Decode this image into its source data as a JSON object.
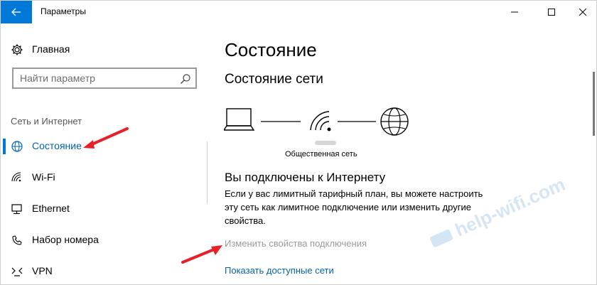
{
  "window": {
    "title": "Параметры"
  },
  "sidebar": {
    "home_label": "Главная",
    "search": {
      "placeholder": "Найти параметр"
    },
    "section_label": "Сеть и Интернет",
    "items": [
      {
        "label": "Состояние",
        "icon": "globe-status-icon",
        "active": true
      },
      {
        "label": "Wi-Fi",
        "icon": "wifi-icon",
        "active": false
      },
      {
        "label": "Ethernet",
        "icon": "ethernet-icon",
        "active": false
      },
      {
        "label": "Набор номера",
        "icon": "dialup-icon",
        "active": false
      },
      {
        "label": "VPN",
        "icon": "vpn-icon",
        "active": false
      }
    ]
  },
  "main": {
    "page_title": "Состояние",
    "network_status_title": "Состояние сети",
    "network_type": "Общественная сеть",
    "connected_title": "Вы подключены к Интернету",
    "connected_desc": "Если у вас лимитный тарифный план, вы можете настроить эту сеть как лимитное подключение или изменить другие свойства.",
    "change_props_link": "Изменить свойства подключения",
    "show_networks_link": "Показать доступные сети"
  },
  "watermark": "help-wifi.com",
  "colors": {
    "accent": "#0078d7",
    "link": "#0063b1",
    "arrow": "#e8202a",
    "disabled_text": "#9a9a9a"
  }
}
